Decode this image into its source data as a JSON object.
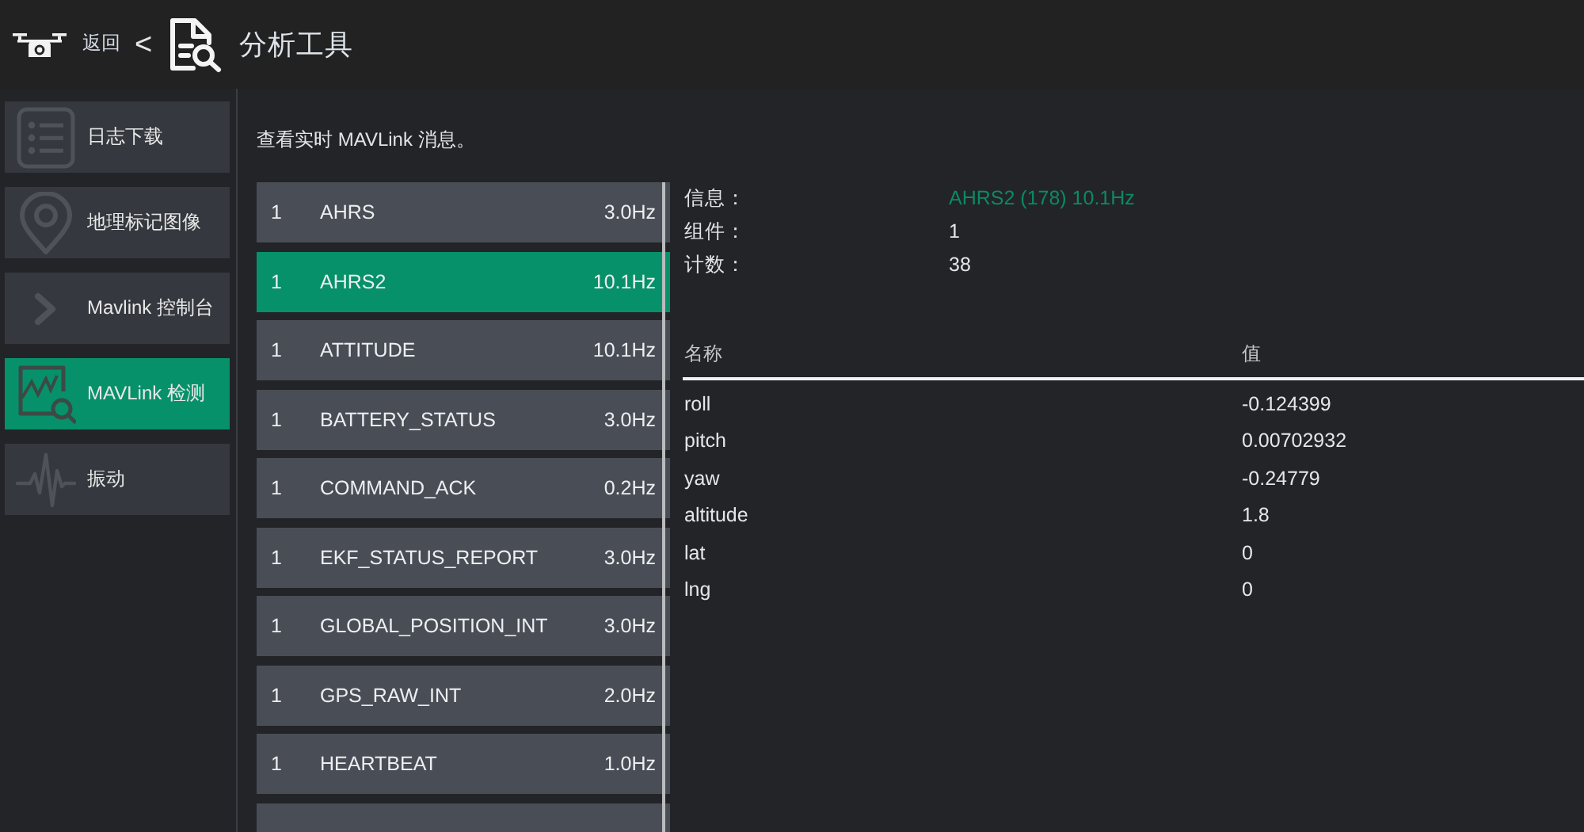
{
  "header": {
    "back_label": "返回",
    "separator": "<",
    "title": "分析工具"
  },
  "sidebar": {
    "items": [
      {
        "label": "日志下载",
        "selected": false
      },
      {
        "label": "地理标记图像",
        "selected": false
      },
      {
        "label": "Mavlink 控制台",
        "selected": false
      },
      {
        "label": "MAVLink 检测",
        "selected": true
      },
      {
        "label": "振动",
        "selected": false
      }
    ]
  },
  "intro": "查看实时 MAVLink 消息。",
  "messages": [
    {
      "component": "1",
      "name": "AHRS",
      "rate": "3.0Hz",
      "selected": false
    },
    {
      "component": "1",
      "name": "AHRS2",
      "rate": "10.1Hz",
      "selected": true
    },
    {
      "component": "1",
      "name": "ATTITUDE",
      "rate": "10.1Hz",
      "selected": false
    },
    {
      "component": "1",
      "name": "BATTERY_STATUS",
      "rate": "3.0Hz",
      "selected": false
    },
    {
      "component": "1",
      "name": "COMMAND_ACK",
      "rate": "0.2Hz",
      "selected": false
    },
    {
      "component": "1",
      "name": "EKF_STATUS_REPORT",
      "rate": "3.0Hz",
      "selected": false
    },
    {
      "component": "1",
      "name": "GLOBAL_POSITION_INT",
      "rate": "3.0Hz",
      "selected": false
    },
    {
      "component": "1",
      "name": "GPS_RAW_INT",
      "rate": "2.0Hz",
      "selected": false
    },
    {
      "component": "1",
      "name": "HEARTBEAT",
      "rate": "1.0Hz",
      "selected": false
    },
    {
      "selected": false
    }
  ],
  "details": {
    "info": [
      {
        "label": "信息：",
        "value": "AHRS2 (178) 10.1Hz",
        "kind": "accent"
      },
      {
        "label": "组件：",
        "value": "1",
        "kind": "plain"
      },
      {
        "label": "计数：",
        "value": "38",
        "kind": "plain"
      }
    ],
    "columns": [
      "名称",
      "值"
    ],
    "rows": [
      {
        "name": "roll",
        "value": "-0.124399"
      },
      {
        "name": "pitch",
        "value": "0.00702932"
      },
      {
        "name": "yaw",
        "value": "-0.24779"
      },
      {
        "name": "altitude",
        "value": "1.8"
      },
      {
        "name": "lat",
        "value": "0"
      },
      {
        "name": "lng",
        "value": "0"
      }
    ]
  }
}
